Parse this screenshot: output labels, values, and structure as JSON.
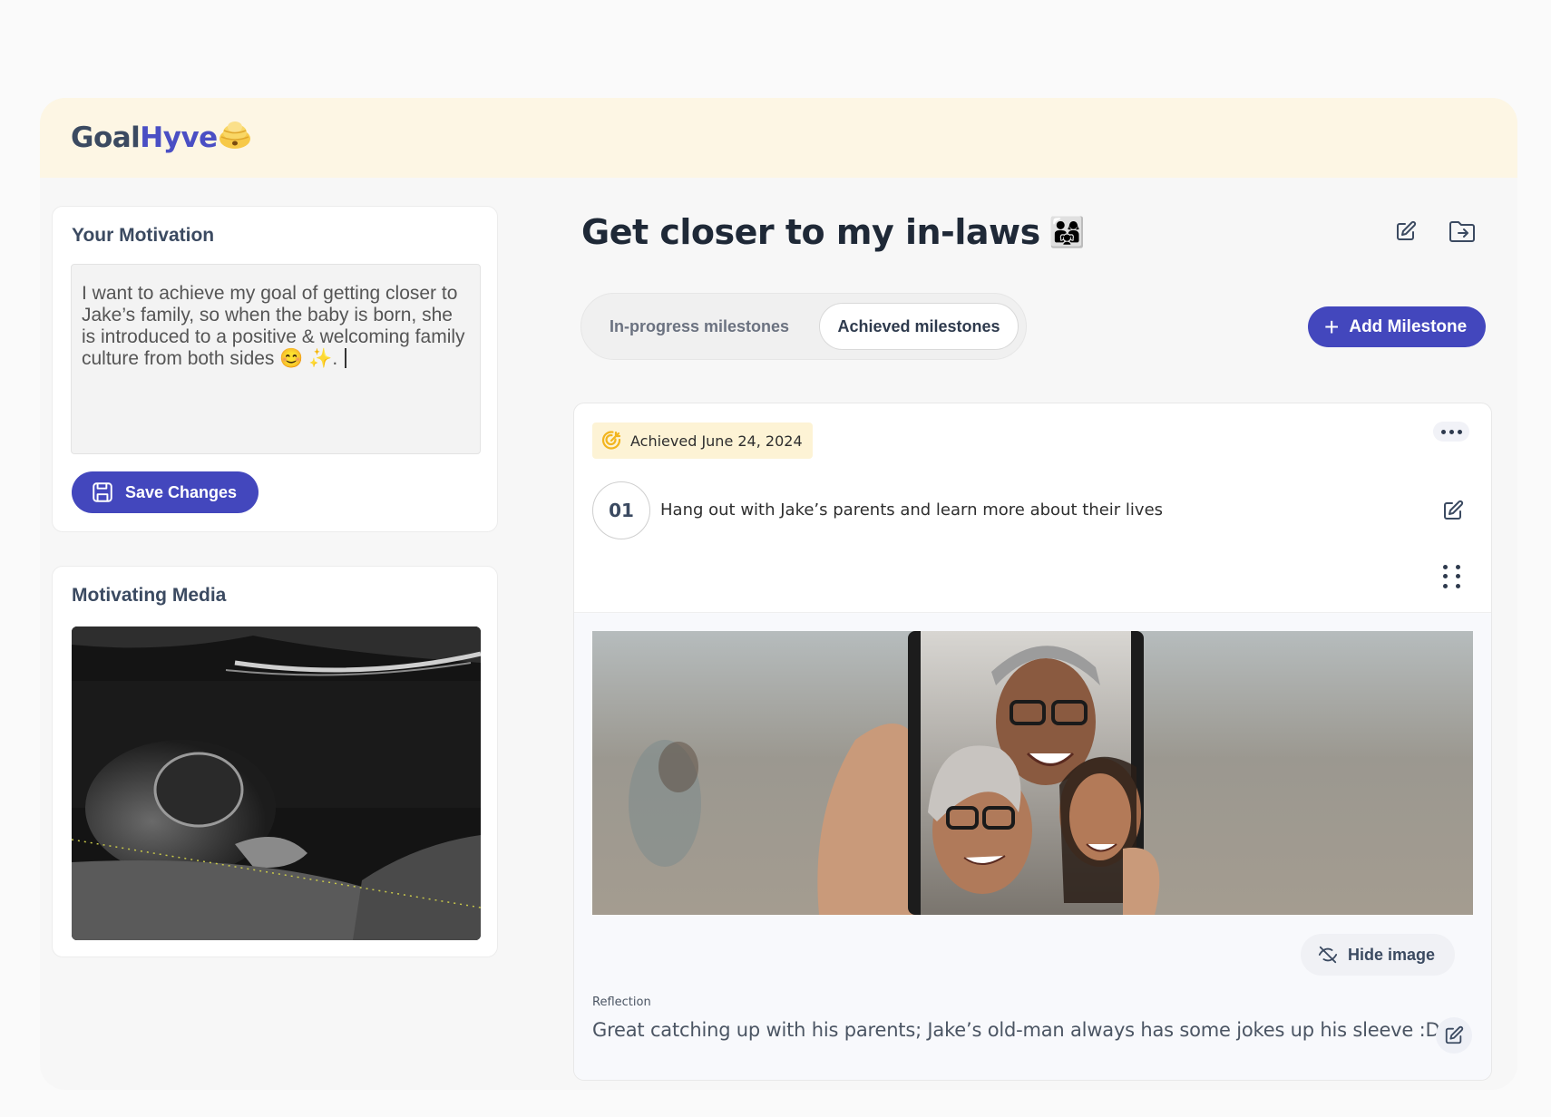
{
  "header": {
    "logo_goal": "Goal",
    "logo_hyve": "Hyve"
  },
  "motivation": {
    "title": "Your Motivation",
    "text": "I want to achieve my goal of getting closer to Jake’s family, so when the baby is born, she is introduced to a positive & welcoming family culture from both sides 😊 ✨.",
    "save_label": "Save Changes"
  },
  "media": {
    "title": "Motivating Media"
  },
  "goal": {
    "title": "Get closer to my in-laws",
    "emoji": "👨‍👩‍👧"
  },
  "tabs": [
    {
      "label": "In-progress milestones",
      "active": false
    },
    {
      "label": "Achieved milestones",
      "active": true
    }
  ],
  "add_milestone_label": "Add Milestone",
  "milestone": {
    "achieved_label": "Achieved June 24, 2024",
    "number": "01",
    "text": "Hang out with Jake’s parents and learn more about their lives",
    "hide_image_label": "Hide image",
    "reflection_label": "Reflection",
    "reflection_text": "Great catching up with his parents; Jake’s old-man always has some jokes up his sleeve :D"
  },
  "colors": {
    "primary": "#4347bd",
    "header_bg": "#fdf6e4",
    "badge_bg": "#fdf3d5",
    "achieved_icon": "#f2b51f"
  },
  "icons": [
    "hive-icon",
    "save-icon",
    "edit-icon",
    "folder-move-icon",
    "plus-icon",
    "target-icon",
    "more-icon",
    "drag-handle-icon",
    "eye-off-icon"
  ]
}
